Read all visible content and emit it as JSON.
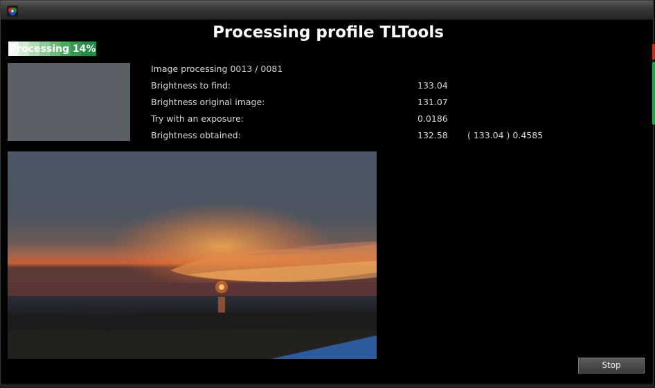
{
  "window": {
    "heading": "Processing profile TLTools",
    "icon": "app-logo-icon"
  },
  "progress": {
    "label": "Processing 14%",
    "percent": 14,
    "fill_color": "#1f8a46",
    "highlight_color": "#e6f4e6"
  },
  "info": {
    "rows": [
      {
        "label": "Image processing 0013 / 0081",
        "value": "",
        "extra": ""
      },
      {
        "label": "Brightness to find:",
        "value": "133.04",
        "extra": ""
      },
      {
        "label": "Brightness original image:",
        "value": "131.07",
        "extra": ""
      },
      {
        "label": "Try with an exposure:",
        "value": "0.0186",
        "extra": ""
      },
      {
        "label": "Brightness obtained:",
        "value": "132.58",
        "extra": "( 133.04 ) 0.4585"
      }
    ]
  },
  "thumbnail": {
    "color": "#5b5f66"
  },
  "buttons": {
    "stop": "Stop"
  },
  "colors": {
    "background": "#000000",
    "text": "#d8d8d8",
    "heading": "#ffffff"
  }
}
